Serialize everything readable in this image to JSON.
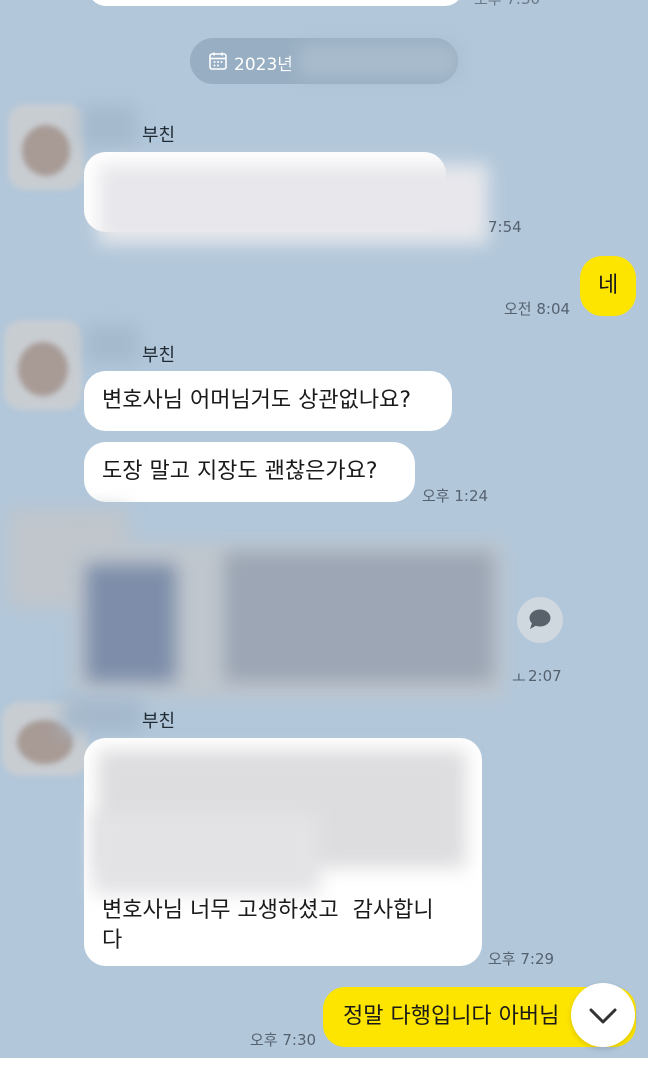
{
  "date_divider": {
    "label": "2023년",
    "icon": "calendar-icon"
  },
  "messages": [
    {
      "type": "incoming-hidden-tail"
    },
    {
      "sender": "부친",
      "text": "",
      "time": "7:54"
    },
    {
      "sender": "me",
      "text": "네",
      "time": "오전 8:04"
    },
    {
      "sender": "부친",
      "text": "변호사님 어머님거도 상관없나요?"
    },
    {
      "sender": "부친",
      "text": "도장 말고 지장도 괜찮은가요?",
      "time": "오후 1:24"
    },
    {
      "sender": "부친",
      "attachment": "image",
      "time": "2:07",
      "time_prefix": "ㅗ"
    },
    {
      "sender": "부친",
      "text": "변호사님 너무 고생하셨고  감사합니\n다",
      "time": "오후 7:29"
    },
    {
      "sender": "me",
      "text": "정말 다행입니다 아버님",
      "time": "오후 7:30"
    }
  ],
  "scroll_down": {
    "icon": "chevron-down-icon"
  },
  "share": {
    "icon": "speech-bubble-icon"
  },
  "colors": {
    "background": "#b2c7da",
    "mine": "#fee500",
    "theirs": "#ffffff"
  }
}
